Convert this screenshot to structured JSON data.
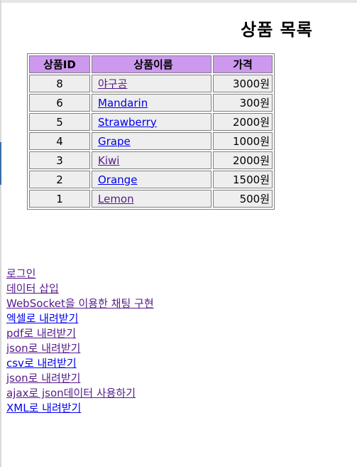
{
  "page": {
    "title": "상품 목록"
  },
  "table": {
    "headers": {
      "id": "상품ID",
      "name": "상품이름",
      "price": "가격"
    },
    "rows": [
      {
        "id": "8",
        "name": "야구공",
        "price": "3000원",
        "visited": true
      },
      {
        "id": "6",
        "name": "Mandarin",
        "price": "300원",
        "visited": false
      },
      {
        "id": "5",
        "name": "Strawberry",
        "price": "2000원",
        "visited": false
      },
      {
        "id": "4",
        "name": "Grape",
        "price": "1000원",
        "visited": false
      },
      {
        "id": "3",
        "name": "Kiwi",
        "price": "2000원",
        "visited": true
      },
      {
        "id": "2",
        "name": "Orange",
        "price": "1500원",
        "visited": false
      },
      {
        "id": "1",
        "name": "Lemon",
        "price": "500원",
        "visited": true
      }
    ]
  },
  "menu": {
    "links": [
      {
        "label": "로그인",
        "visited": true
      },
      {
        "label": "데이터 삽입",
        "visited": true
      },
      {
        "label": "WebSocket을 이용한 채팅 구현",
        "visited": true
      },
      {
        "label": "엑셀로 내려받기",
        "visited": false
      },
      {
        "label": "pdf로 내려받기",
        "visited": true
      },
      {
        "label": "json로 내려받기",
        "visited": true
      },
      {
        "label": "csv로 내려받기",
        "visited": false
      },
      {
        "label": "json로 내려받기",
        "visited": true
      },
      {
        "label": "ajax로 json데이터 사용하기",
        "visited": true
      },
      {
        "label": "XML로 내려받기",
        "visited": false
      }
    ]
  },
  "colors": {
    "header_bg": "#cc99ee",
    "cell_bg": "#eeeeee",
    "link_unvisited": "#0000ee",
    "link_visited": "#551a8b"
  }
}
